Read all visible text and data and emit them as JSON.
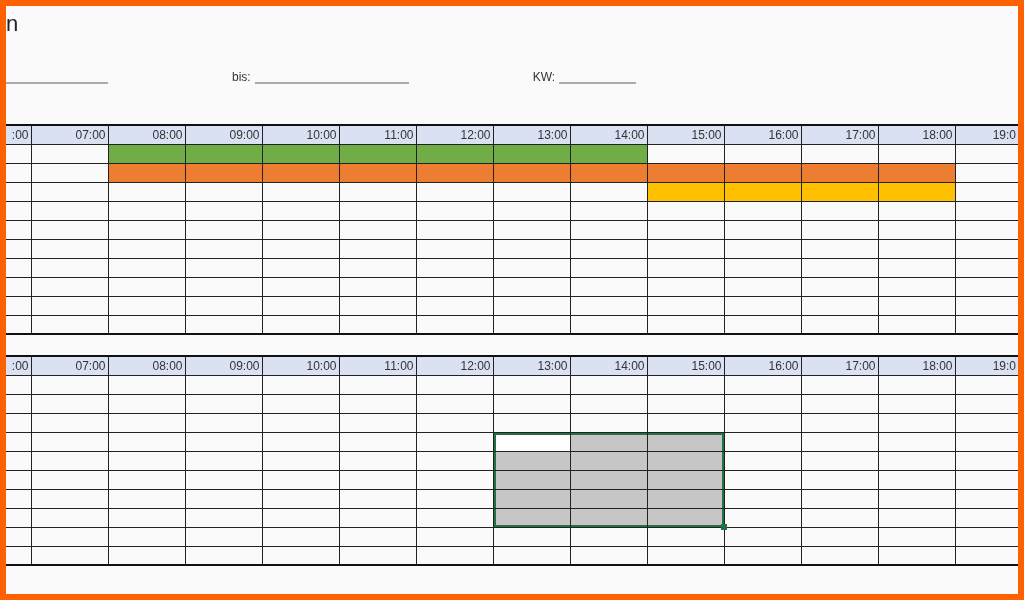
{
  "title": "n",
  "fields": [
    {
      "kind": "blank-line"
    },
    {
      "kind": "labeled-line",
      "label": "bis:"
    },
    {
      "kind": "labeled-line",
      "label": "KW:"
    }
  ],
  "tables": [
    {
      "columns": [
        ":00",
        "07:00",
        "08:00",
        "09:00",
        "10:00",
        "11:00",
        "12:00",
        "13:00",
        "14:00",
        "15:00",
        "16:00",
        "17:00",
        "18:00",
        "19:0"
      ],
      "rows": [
        {
          "cells": [
            {},
            {},
            {
              "color": "#70ad47"
            },
            {
              "color": "#70ad47"
            },
            {
              "color": "#70ad47"
            },
            {
              "color": "#70ad47"
            },
            {
              "color": "#70ad47"
            },
            {
              "color": "#70ad47"
            },
            {
              "color": "#70ad47"
            },
            {},
            {},
            {},
            {},
            {}
          ]
        },
        {
          "cells": [
            {},
            {},
            {
              "color": "#ed7d31"
            },
            {
              "color": "#ed7d31"
            },
            {
              "color": "#ed7d31"
            },
            {
              "color": "#ed7d31"
            },
            {
              "color": "#ed7d31"
            },
            {
              "color": "#ed7d31"
            },
            {
              "color": "#ed7d31"
            },
            {
              "color": "#ed7d31"
            },
            {
              "color": "#ed7d31"
            },
            {
              "color": "#ed7d31"
            },
            {
              "color": "#ed7d31"
            },
            {}
          ]
        },
        {
          "cells": [
            {},
            {},
            {},
            {},
            {},
            {},
            {},
            {},
            {},
            {
              "color": "#ffc000"
            },
            {
              "color": "#ffc000"
            },
            {
              "color": "#ffc000"
            },
            {
              "color": "#ffc000"
            },
            {}
          ]
        },
        {
          "cells": [
            {},
            {},
            {},
            {},
            {},
            {},
            {},
            {},
            {},
            {},
            {},
            {},
            {},
            {}
          ]
        },
        {
          "cells": [
            {},
            {},
            {},
            {},
            {},
            {},
            {},
            {},
            {},
            {},
            {},
            {},
            {},
            {}
          ]
        },
        {
          "cells": [
            {},
            {},
            {},
            {},
            {},
            {},
            {},
            {},
            {},
            {},
            {},
            {},
            {},
            {}
          ]
        },
        {
          "cells": [
            {},
            {},
            {},
            {},
            {},
            {},
            {},
            {},
            {},
            {},
            {},
            {},
            {},
            {}
          ]
        },
        {
          "cells": [
            {},
            {},
            {},
            {},
            {},
            {},
            {},
            {},
            {},
            {},
            {},
            {},
            {},
            {}
          ]
        },
        {
          "cells": [
            {},
            {},
            {},
            {},
            {},
            {},
            {},
            {},
            {},
            {},
            {},
            {},
            {},
            {}
          ]
        },
        {
          "cells": [
            {},
            {},
            {},
            {},
            {},
            {},
            {},
            {},
            {},
            {},
            {},
            {},
            {},
            {}
          ]
        }
      ]
    },
    {
      "columns": [
        ":00",
        "07:00",
        "08:00",
        "09:00",
        "10:00",
        "11:00",
        "12:00",
        "13:00",
        "14:00",
        "15:00",
        "16:00",
        "17:00",
        "18:00",
        "19:0"
      ],
      "rows": [
        {
          "cells": [
            {
              "selected": false,
              "active": false
            },
            {
              "selected": false,
              "active": false
            },
            {
              "selected": false,
              "active": false
            },
            {
              "selected": false,
              "active": false
            },
            {
              "selected": false,
              "active": false
            },
            {
              "selected": false,
              "active": false
            },
            {
              "selected": false,
              "active": false
            },
            {
              "selected": false,
              "active": false
            },
            {
              "selected": false,
              "active": false
            },
            {
              "selected": false,
              "active": false
            },
            {
              "selected": false,
              "active": false
            },
            {
              "selected": false,
              "active": false
            },
            {
              "selected": false,
              "active": false
            },
            {
              "selected": false,
              "active": false
            }
          ]
        },
        {
          "cells": [
            {
              "selected": false,
              "active": false
            },
            {
              "selected": false,
              "active": false
            },
            {
              "selected": false,
              "active": false
            },
            {
              "selected": false,
              "active": false
            },
            {
              "selected": false,
              "active": false
            },
            {
              "selected": false,
              "active": false
            },
            {
              "selected": false,
              "active": false
            },
            {
              "selected": false,
              "active": false
            },
            {
              "selected": false,
              "active": false
            },
            {
              "selected": false,
              "active": false
            },
            {
              "selected": false,
              "active": false
            },
            {
              "selected": false,
              "active": false
            },
            {
              "selected": false,
              "active": false
            },
            {
              "selected": false,
              "active": false
            }
          ]
        },
        {
          "cells": [
            {
              "selected": false,
              "active": false
            },
            {
              "selected": false,
              "active": false
            },
            {
              "selected": false,
              "active": false
            },
            {
              "selected": false,
              "active": false
            },
            {
              "selected": false,
              "active": false
            },
            {
              "selected": false,
              "active": false
            },
            {
              "selected": false,
              "active": false
            },
            {
              "selected": false,
              "active": false
            },
            {
              "selected": false,
              "active": false
            },
            {
              "selected": false,
              "active": false
            },
            {
              "selected": false,
              "active": false
            },
            {
              "selected": false,
              "active": false
            },
            {
              "selected": false,
              "active": false
            },
            {
              "selected": false,
              "active": false
            }
          ]
        },
        {
          "cells": [
            {
              "selected": false,
              "active": false
            },
            {
              "selected": false,
              "active": false
            },
            {
              "selected": false,
              "active": false
            },
            {
              "selected": false,
              "active": false
            },
            {
              "selected": false,
              "active": false
            },
            {
              "selected": false,
              "active": false
            },
            {
              "selected": false,
              "active": false
            },
            {
              "selected": true,
              "active": true
            },
            {
              "selected": true,
              "active": false
            },
            {
              "selected": true,
              "active": false
            },
            {
              "selected": false,
              "active": false
            },
            {
              "selected": false,
              "active": false
            },
            {
              "selected": false,
              "active": false
            },
            {
              "selected": false,
              "active": false
            }
          ]
        },
        {
          "cells": [
            {
              "selected": false,
              "active": false
            },
            {
              "selected": false,
              "active": false
            },
            {
              "selected": false,
              "active": false
            },
            {
              "selected": false,
              "active": false
            },
            {
              "selected": false,
              "active": false
            },
            {
              "selected": false,
              "active": false
            },
            {
              "selected": false,
              "active": false
            },
            {
              "selected": true,
              "active": false
            },
            {
              "selected": true,
              "active": false
            },
            {
              "selected": true,
              "active": false
            },
            {
              "selected": false,
              "active": false
            },
            {
              "selected": false,
              "active": false
            },
            {
              "selected": false,
              "active": false
            },
            {
              "selected": false,
              "active": false
            }
          ]
        },
        {
          "cells": [
            {
              "selected": false,
              "active": false
            },
            {
              "selected": false,
              "active": false
            },
            {
              "selected": false,
              "active": false
            },
            {
              "selected": false,
              "active": false
            },
            {
              "selected": false,
              "active": false
            },
            {
              "selected": false,
              "active": false
            },
            {
              "selected": false,
              "active": false
            },
            {
              "selected": true,
              "active": false
            },
            {
              "selected": true,
              "active": false
            },
            {
              "selected": true,
              "active": false
            },
            {
              "selected": false,
              "active": false
            },
            {
              "selected": false,
              "active": false
            },
            {
              "selected": false,
              "active": false
            },
            {
              "selected": false,
              "active": false
            }
          ]
        },
        {
          "cells": [
            {
              "selected": false,
              "active": false
            },
            {
              "selected": false,
              "active": false
            },
            {
              "selected": false,
              "active": false
            },
            {
              "selected": false,
              "active": false
            },
            {
              "selected": false,
              "active": false
            },
            {
              "selected": false,
              "active": false
            },
            {
              "selected": false,
              "active": false
            },
            {
              "selected": true,
              "active": false
            },
            {
              "selected": true,
              "active": false
            },
            {
              "selected": true,
              "active": false
            },
            {
              "selected": false,
              "active": false
            },
            {
              "selected": false,
              "active": false
            },
            {
              "selected": false,
              "active": false
            },
            {
              "selected": false,
              "active": false
            }
          ]
        },
        {
          "cells": [
            {
              "selected": false,
              "active": false
            },
            {
              "selected": false,
              "active": false
            },
            {
              "selected": false,
              "active": false
            },
            {
              "selected": false,
              "active": false
            },
            {
              "selected": false,
              "active": false
            },
            {
              "selected": false,
              "active": false
            },
            {
              "selected": false,
              "active": false
            },
            {
              "selected": true,
              "active": false
            },
            {
              "selected": true,
              "active": false
            },
            {
              "selected": true,
              "active": false
            },
            {
              "selected": false,
              "active": false
            },
            {
              "selected": false,
              "active": false
            },
            {
              "selected": false,
              "active": false
            },
            {
              "selected": false,
              "active": false
            }
          ]
        },
        {
          "cells": [
            {
              "selected": false,
              "active": false
            },
            {
              "selected": false,
              "active": false
            },
            {
              "selected": false,
              "active": false
            },
            {
              "selected": false,
              "active": false
            },
            {
              "selected": false,
              "active": false
            },
            {
              "selected": false,
              "active": false
            },
            {
              "selected": false,
              "active": false
            },
            {
              "selected": false,
              "active": false
            },
            {
              "selected": false,
              "active": false
            },
            {
              "selected": false,
              "active": false
            },
            {
              "selected": false,
              "active": false
            },
            {
              "selected": false,
              "active": false
            },
            {
              "selected": false,
              "active": false
            },
            {
              "selected": false,
              "active": false
            }
          ]
        },
        {
          "cells": [
            {
              "selected": false,
              "active": false
            },
            {
              "selected": false,
              "active": false
            },
            {
              "selected": false,
              "active": false
            },
            {
              "selected": false,
              "active": false
            },
            {
              "selected": false,
              "active": false
            },
            {
              "selected": false,
              "active": false
            },
            {
              "selected": false,
              "active": false
            },
            {
              "selected": false,
              "active": false
            },
            {
              "selected": false,
              "active": false
            },
            {
              "selected": false,
              "active": false
            },
            {
              "selected": false,
              "active": false
            },
            {
              "selected": false,
              "active": false
            },
            {
              "selected": false,
              "active": false
            },
            {
              "selected": false,
              "active": false
            }
          ]
        }
      ]
    }
  ]
}
